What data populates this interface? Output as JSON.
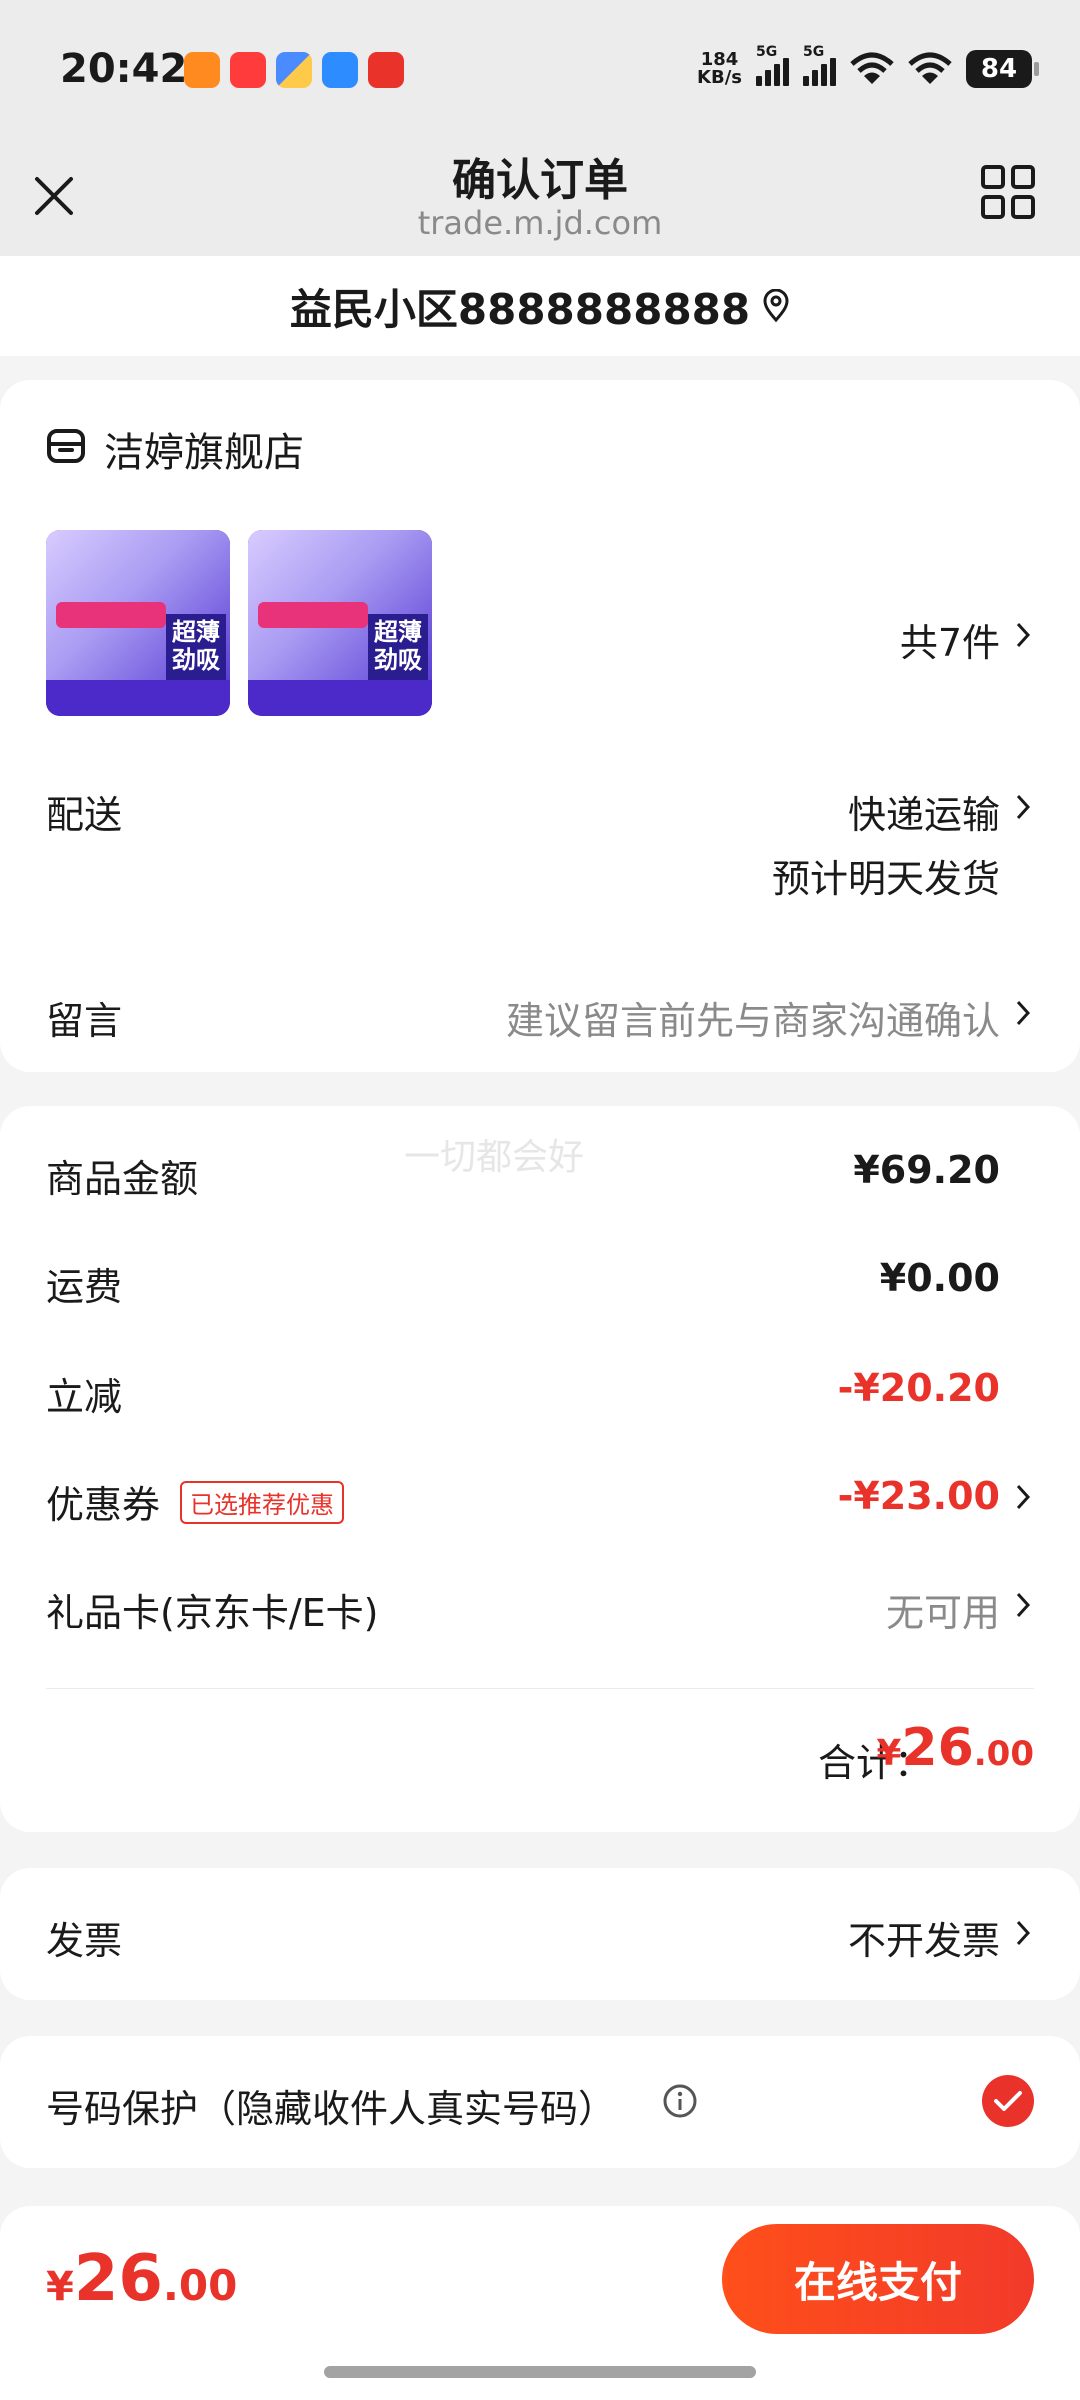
{
  "status_bar": {
    "time": "20:42",
    "net_speed_value": "184",
    "net_speed_unit": "KB/s",
    "sim1_label": "5G",
    "sim2_label": "5G",
    "battery": "84"
  },
  "header": {
    "title": "确认订单",
    "url": "trade.m.jd.com"
  },
  "address": {
    "text": "益民小区8888888888"
  },
  "store": {
    "name": "洁婷旗舰店",
    "count_label": "共7件",
    "thumbnails": [
      {
        "badge_line1": "超薄",
        "badge_line2": "劲吸"
      },
      {
        "badge_line1": "超薄",
        "badge_line2": "劲吸"
      }
    ]
  },
  "delivery": {
    "label": "配送",
    "method": "快递运输",
    "eta": "预计明天发货"
  },
  "message": {
    "label": "留言",
    "placeholder": "建议留言前先与商家沟通确认"
  },
  "summary": {
    "watermark": "一切都会好",
    "goods_label": "商品金额",
    "goods_value": "¥69.20",
    "shipping_label": "运费",
    "shipping_value": "¥0.00",
    "discount_label": "立减",
    "discount_value": "-¥20.20",
    "coupon_label": "优惠券",
    "coupon_tag": "已选推荐优惠",
    "coupon_value": "-¥23.00",
    "giftcard_label": "礼品卡(京东卡/E卡)",
    "giftcard_value": "无可用",
    "total_label": "合计：",
    "total_currency": "¥",
    "total_int": "26",
    "total_dec": ".00"
  },
  "invoice": {
    "label": "发票",
    "value": "不开发票"
  },
  "privacy": {
    "label": "号码保护（隐藏收件人真实号码）",
    "checked": true
  },
  "bottom": {
    "currency": "¥",
    "price_int": "26",
    "price_dec": ".00",
    "pay_label": "在线支付"
  },
  "colors": {
    "accent_red": "#e8322a",
    "button_gradient_start": "#ff4f1a",
    "button_gradient_end": "#f23a2a"
  }
}
